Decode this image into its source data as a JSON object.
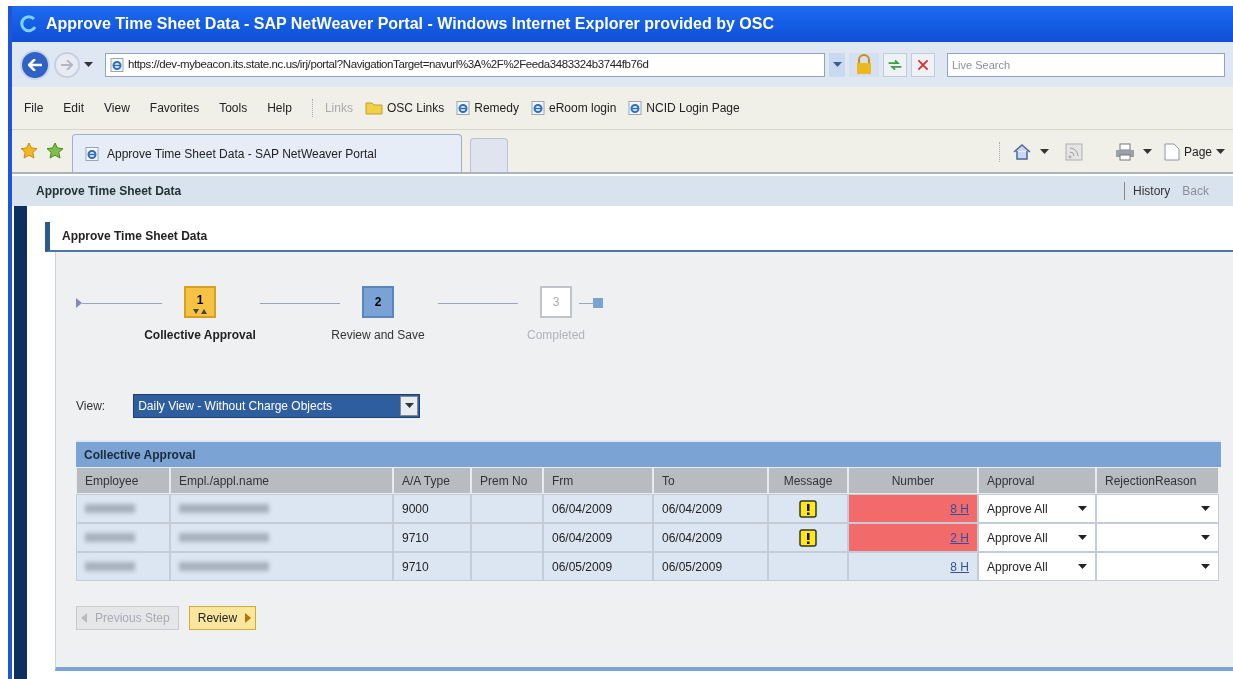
{
  "window": {
    "title": "Approve Time Sheet Data - SAP NetWeaver Portal - Windows Internet Explorer provided by OSC"
  },
  "address_bar": {
    "url": "https://dev-mybeacon.its.state.nc.us/irj/portal?NavigationTarget=navurl%3A%2F%2Feeda3483324b3744fb76d",
    "search_placeholder": "Live Search"
  },
  "menu": [
    "File",
    "Edit",
    "View",
    "Favorites",
    "Tools",
    "Help"
  ],
  "links": {
    "label": "Links",
    "items": [
      {
        "label": "OSC Links",
        "kind": "folder"
      },
      {
        "label": "Remedy",
        "kind": "page"
      },
      {
        "label": "eRoom login",
        "kind": "page"
      },
      {
        "label": "NCID Login Page",
        "kind": "page"
      }
    ]
  },
  "tabs": [
    {
      "label": "Approve Time Sheet Data - SAP NetWeaver Portal",
      "selected": true
    }
  ],
  "command_bar": {
    "page_label": "Page"
  },
  "portal_header": {
    "title": "Approve Time Sheet Data",
    "history": "History",
    "back": "Back"
  },
  "panel": {
    "title": "Approve Time Sheet Data"
  },
  "steps": [
    {
      "number": "1",
      "label": "Collective Approval",
      "current": true,
      "disabled": false
    },
    {
      "number": "2",
      "label": "Review and Save",
      "current": false,
      "disabled": false
    },
    {
      "number": "3",
      "label": "Completed",
      "current": false,
      "disabled": true
    }
  ],
  "view": {
    "label": "View:",
    "value": "Daily View - Without Charge Objects"
  },
  "table": {
    "title": "Collective Approval",
    "columns": [
      "Employee",
      "Empl./appl.name",
      "A/A Type",
      "Prem No",
      "Frm",
      "To",
      "Message",
      "Number",
      "Approval",
      "RejectionReason"
    ],
    "rows": [
      {
        "type": "9000",
        "from": "06/04/2009",
        "to": "06/04/2009",
        "warning": true,
        "number": "8 H",
        "error": true,
        "approval": "Approve All"
      },
      {
        "type": "9710",
        "from": "06/04/2009",
        "to": "06/04/2009",
        "warning": true,
        "number": "2 H",
        "error": true,
        "approval": "Approve All"
      },
      {
        "type": "9710",
        "from": "06/05/2009",
        "to": "06/05/2009",
        "warning": false,
        "number": "8 H",
        "error": false,
        "approval": "Approve All"
      }
    ]
  },
  "buttons": [
    {
      "label": "Previous Step",
      "disabled": true
    },
    {
      "label": "Review",
      "disabled": false
    }
  ]
}
